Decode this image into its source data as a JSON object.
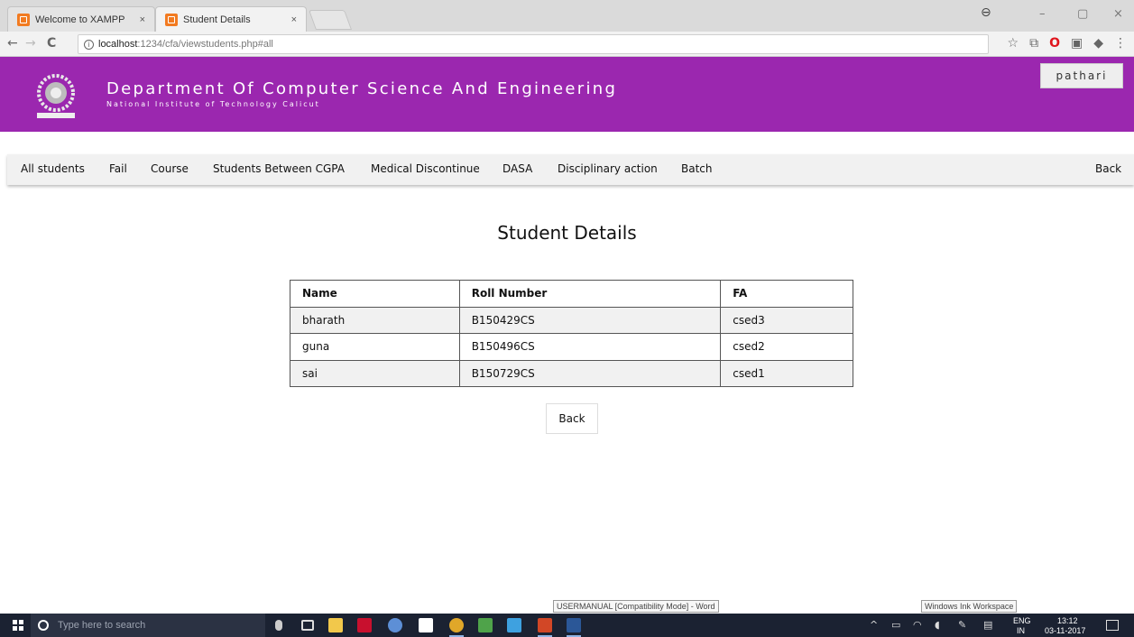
{
  "browser": {
    "tabs": [
      {
        "title": "Welcome to XAMPP",
        "close": "×"
      },
      {
        "title": "Student Details",
        "close": "×"
      }
    ],
    "url_host": "localhost",
    "url_path": ":1234/cfa/viewstudents.php#all",
    "nav": {
      "back": "←",
      "forward": "→",
      "reload": "C"
    },
    "window_controls": {
      "user": "⊖",
      "minimize": "–",
      "maximize": "▢",
      "close": "×"
    },
    "extensions": {
      "star": "☆",
      "cast": "⧉",
      "opera": "O",
      "ext1": "▣",
      "ext2": "◆",
      "menu": "⋮"
    }
  },
  "header": {
    "department": "Department Of Computer Science And Engineering",
    "institute": "National Institute of Technology Calicut",
    "user": "pathari",
    "accent": "#9b27af"
  },
  "menu": {
    "items": [
      "All students",
      "Fail",
      "Course",
      "Students Between CGPA",
      "Medical Discontinue",
      "DASA",
      "Disciplinary action",
      "Batch"
    ],
    "back": "Back"
  },
  "page": {
    "heading": "Student Details",
    "table": {
      "headers": [
        "Name",
        "Roll Number",
        "FA"
      ],
      "rows": [
        [
          "bharath",
          "B150429CS",
          "csed3"
        ],
        [
          "guna",
          "B150496CS",
          "csed2"
        ],
        [
          "sai",
          "B150729CS",
          "csed1"
        ]
      ]
    },
    "back_button": "Back"
  },
  "tooltips": {
    "word": "USERMANUAL [Compatibility Mode] - Word",
    "ink": "Windows Ink Workspace"
  },
  "taskbar": {
    "search_placeholder": "Type here to search",
    "lang_top": "ENG",
    "lang_bottom": "IN",
    "time": "13:12",
    "date": "03-11-2017"
  }
}
